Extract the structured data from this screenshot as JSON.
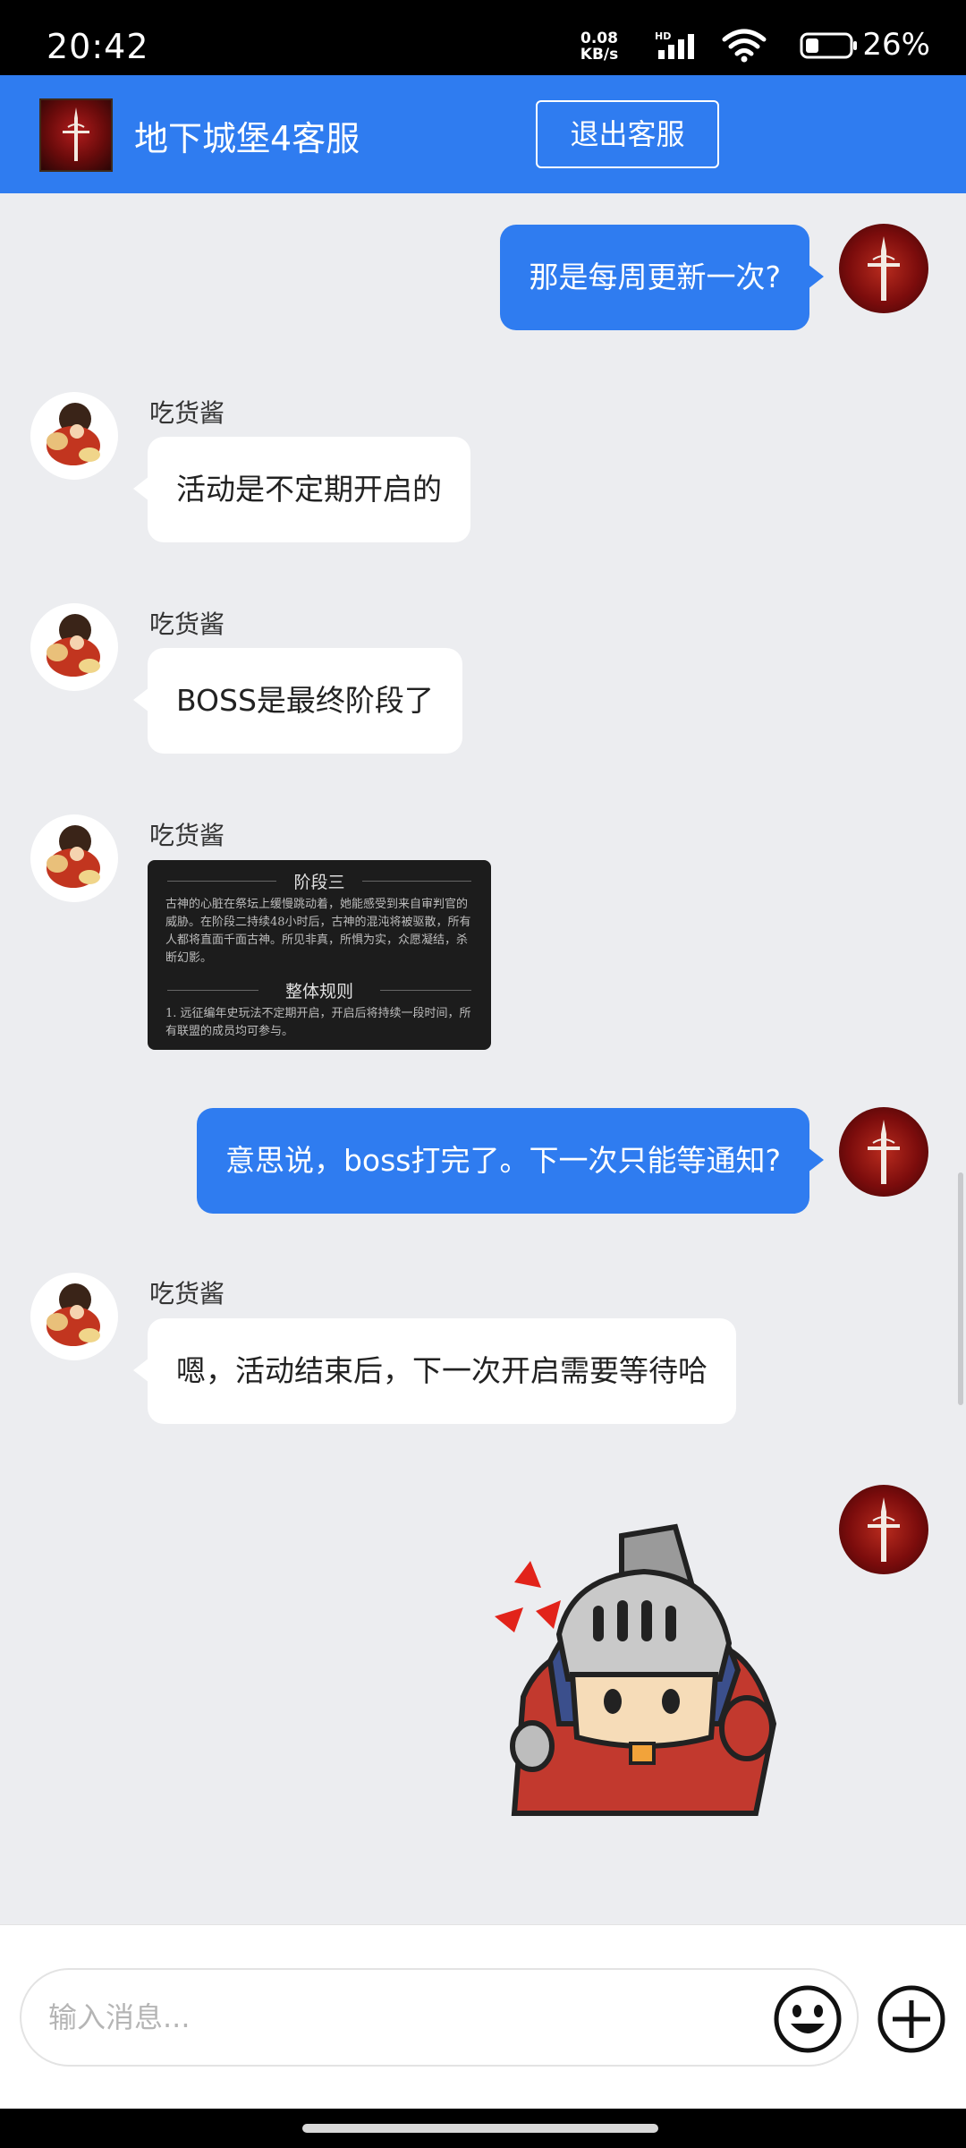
{
  "status_bar": {
    "time": "20:42",
    "net_speed_value": "0.08",
    "net_speed_unit": "KB/s",
    "hd": "HD",
    "battery_percent": "26%"
  },
  "header": {
    "title": "地下城堡4客服",
    "exit_label": "退出客服",
    "bg_color": "#2f7cf0"
  },
  "messages": [
    {
      "from": "agent",
      "text": "那是每周更新一次?"
    },
    {
      "from": "user",
      "sender": "吃货酱",
      "text": "活动是不定期开启的"
    },
    {
      "from": "user",
      "sender": "吃货酱",
      "text": "BOSS是最终阶段了"
    },
    {
      "from": "user",
      "sender": "吃货酱",
      "type": "image",
      "image": {
        "heading1": "阶段三",
        "body1": "古神的心脏在祭坛上缓慢跳动着，她能感受到来自审判官的威胁。在阶段二持续48小时后，古神的混沌将被驱散，所有人都将直面千面古神。所见非真，所惧为实，众愿凝结，杀断幻影。",
        "heading2": "整体规则",
        "body2": "1. 远征编年史玩法不定期开启，开启后将持续一段时间，所有联盟的成员均可参与。"
      }
    },
    {
      "from": "agent",
      "text": "意思说，boss打完了。下一次只能等通知?"
    },
    {
      "from": "user",
      "sender": "吃货酱",
      "text": "嗯，活动结束后，下一次开启需要等待哈"
    },
    {
      "from": "agent",
      "type": "sticker",
      "sticker": "knight-angry-sticker"
    }
  ],
  "input": {
    "placeholder": "输入消息..."
  },
  "icons": {
    "emoji": "smiley-icon",
    "plus": "plus-icon"
  }
}
